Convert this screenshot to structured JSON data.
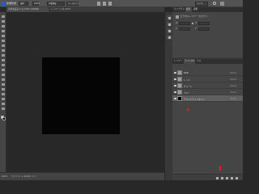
{
  "app": {
    "title_label": "新規作成",
    "menu_badge": "フィル"
  },
  "options": {
    "fields": [
      "通常",
      "100%",
      "不透明度",
      "ベースカラー"
    ]
  },
  "tabs": [
    {
      "label": "名称未設定-1 @ 100% (RGB/8)"
    },
    {
      "label": "レイヤー 1 @ 100%"
    }
  ],
  "status": {
    "zoom": "100%",
    "doc_info": "ファイル : 1.41M/0 バイト"
  },
  "properties": {
    "tabs": [
      "ライブラリ",
      "属性",
      "調整"
    ],
    "title": "ピクセルレイヤー プロパティ",
    "w_label": "W",
    "h_label": "H",
    "x_label": "X",
    "y_label": "Y",
    "w_value": "",
    "h_value": "",
    "x_value": "",
    "y_value": ""
  },
  "layers": {
    "tabs": [
      "レイヤー",
      "チャンネル",
      "パス"
    ],
    "items": [
      {
        "name": "RGB",
        "shortcut": "Ctrl+2",
        "thumb": "gray"
      },
      {
        "name": "レッド",
        "shortcut": "Ctrl+3",
        "thumb": "gray"
      },
      {
        "name": "グリーン",
        "shortcut": "Ctrl+4",
        "thumb": "gray"
      },
      {
        "name": "ブルー",
        "shortcut": "Ctrl+5",
        "thumb": "gray"
      },
      {
        "name": "アルファチャンネル 1",
        "shortcut": "Ctrl+6",
        "thumb": "black",
        "selected": true
      }
    ]
  },
  "colors": {
    "highlight": "#e02020",
    "panel": "#454545",
    "canvas": "#050505"
  },
  "icons": [
    "app-icon",
    "home-icon",
    "eye-icon",
    "dot-circle-icon",
    "selection-icon",
    "new-channel-icon",
    "trash-icon"
  ]
}
